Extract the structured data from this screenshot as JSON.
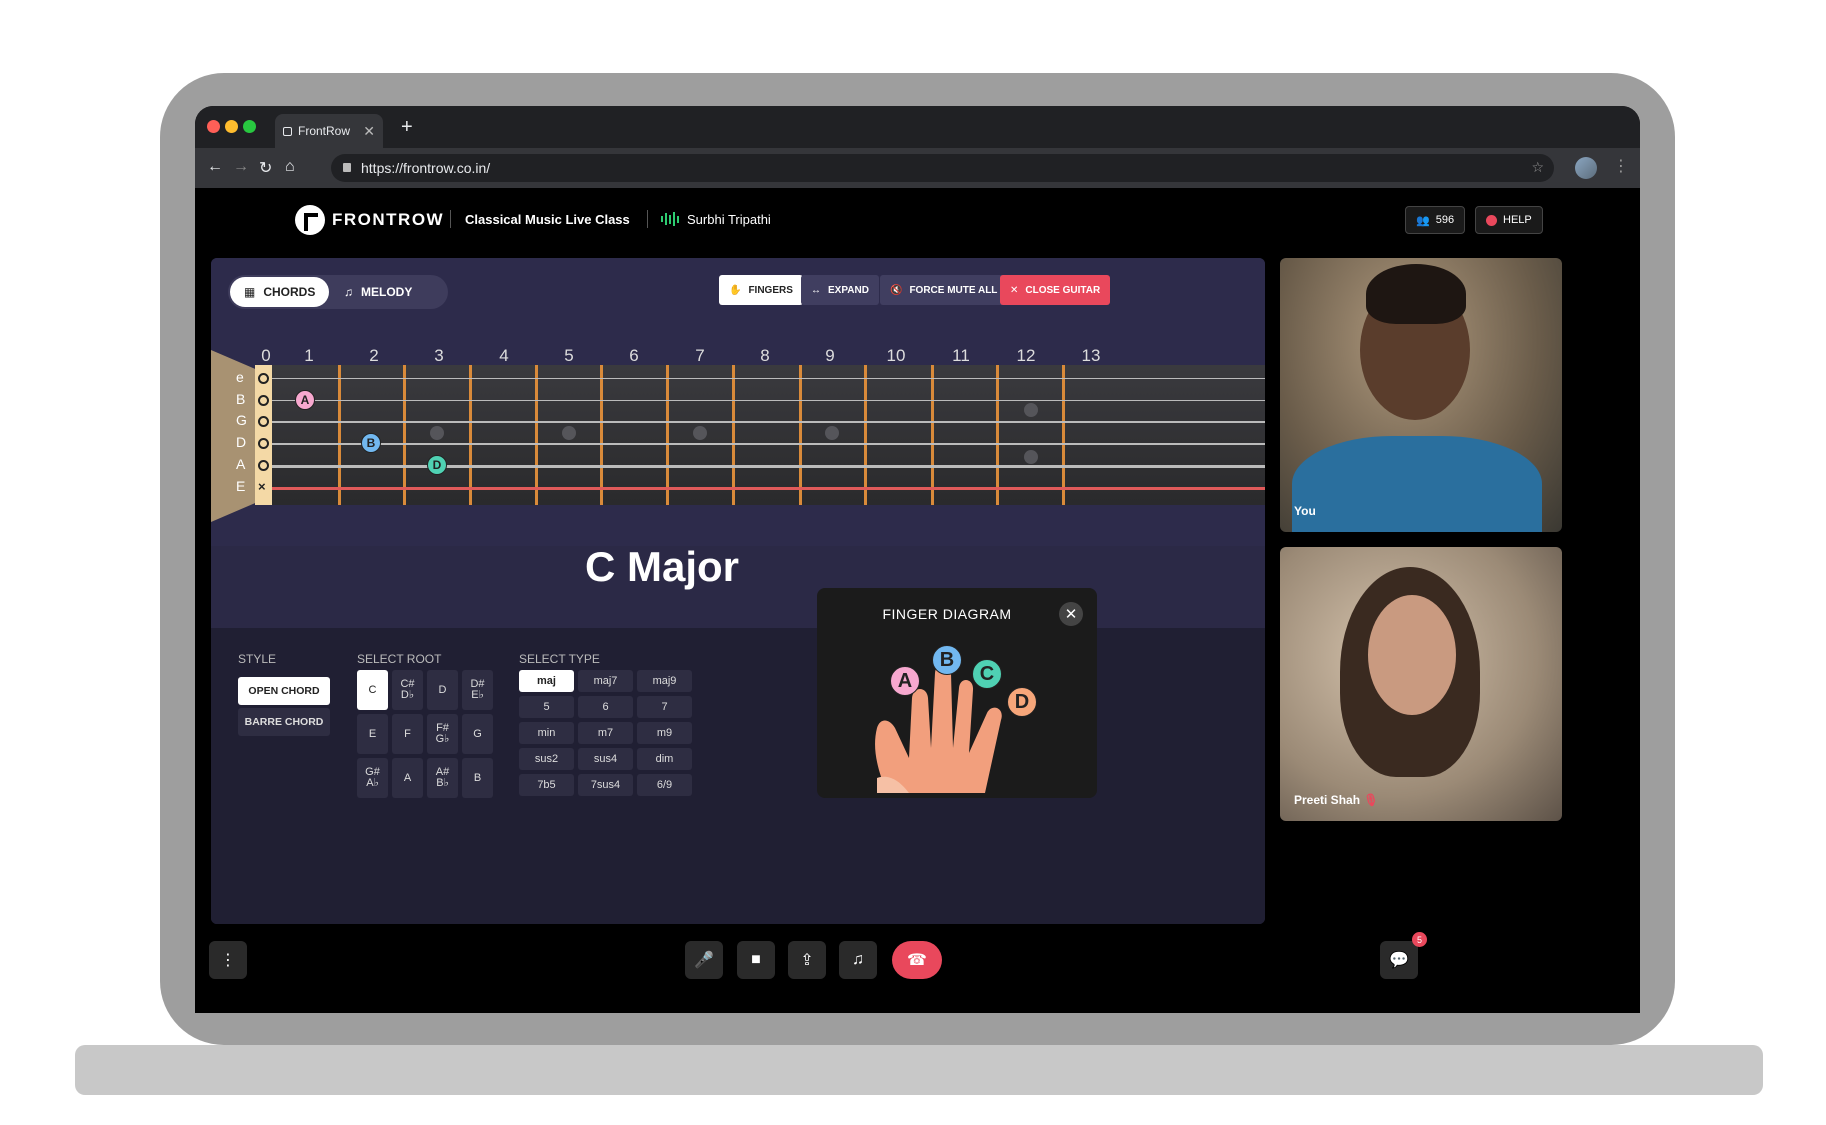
{
  "browser": {
    "tab_title": "FrontRow",
    "new_tab": "+",
    "tab_close": "✕",
    "url": "https://frontrow.co.in/",
    "traffic_colors": [
      "#ff5f57",
      "#febc2e",
      "#28c840"
    ]
  },
  "header": {
    "brand": "FRONTROW",
    "class_title": "Classical Music Live Class",
    "teacher": "Surbhi Tripathi",
    "participant_count": "596",
    "help_label": "HELP"
  },
  "toolbar": {
    "chords_label": "CHORDS",
    "melody_label": "MELODY",
    "fingers_label": "FINGERS",
    "expand_label": "EXPAND",
    "force_mute_label": "FORCE MUTE ALL",
    "close_guitar_label": "CLOSE GUITAR",
    "close_guitar_color": "#e9485c"
  },
  "fretboard": {
    "fret_numbers": [
      "0",
      "1",
      "2",
      "3",
      "4",
      "5",
      "6",
      "7",
      "8",
      "9",
      "10",
      "11",
      "12",
      "13"
    ],
    "strings": [
      "e",
      "B",
      "G",
      "D",
      "A",
      "E"
    ],
    "open_marker": "o",
    "muted_marker": "×",
    "fingers": [
      {
        "label": "A",
        "string": "B",
        "fret": 1,
        "color": "#f7a8cf"
      },
      {
        "label": "B",
        "string": "D",
        "fret": 2,
        "color": "#72b8f0"
      },
      {
        "label": "D",
        "string": "A",
        "fret": 3,
        "color": "#4fd1b3"
      }
    ]
  },
  "chord": {
    "name": "C Major"
  },
  "style": {
    "label": "STYLE",
    "options": [
      "OPEN CHORD",
      "BARRE CHORD"
    ],
    "selected": "OPEN CHORD"
  },
  "root": {
    "label": "SELECT ROOT",
    "options": [
      [
        "C",
        ""
      ],
      [
        "C#",
        "D♭"
      ],
      [
        "D",
        ""
      ],
      [
        "D#",
        "E♭"
      ],
      [
        "E",
        ""
      ],
      [
        "F",
        ""
      ],
      [
        "F#",
        "G♭"
      ],
      [
        "G",
        ""
      ],
      [
        "G#",
        "A♭"
      ],
      [
        "A",
        ""
      ],
      [
        "A#",
        "B♭"
      ],
      [
        "B",
        ""
      ]
    ],
    "selected": "C"
  },
  "type": {
    "label": "SELECT TYPE",
    "options": [
      "maj",
      "maj7",
      "maj9",
      "5",
      "6",
      "7",
      "min",
      "m7",
      "m9",
      "sus2",
      "sus4",
      "dim",
      "7b5",
      "7sus4",
      "6/9"
    ],
    "selected": "maj"
  },
  "finger_diagram": {
    "title": "FINGER DIAGRAM",
    "close": "✕",
    "fingers": [
      {
        "label": "A",
        "color": "#f7a8cf"
      },
      {
        "label": "B",
        "color": "#72b8f0"
      },
      {
        "label": "C",
        "color": "#4fd1b3"
      },
      {
        "label": "D",
        "color": "#f6a67a"
      }
    ]
  },
  "videos": [
    {
      "name": "You"
    },
    {
      "name": "Preeti Shah"
    }
  ],
  "controls": {
    "chat_badge": "5"
  }
}
